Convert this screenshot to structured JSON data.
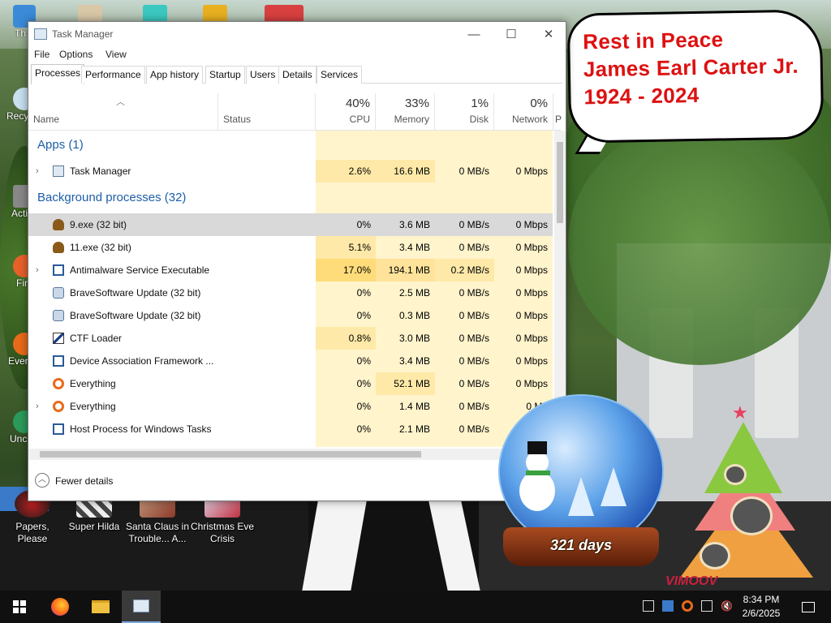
{
  "desktop": {
    "banner_lines": [
      "Rest in Peace",
      "James Earl Carter Jr.",
      "1924 - 2024"
    ],
    "edge_labels": [
      "Th",
      "Recy",
      "Acti",
      "Fir",
      "Ever",
      "Unc"
    ],
    "icons": [
      {
        "label": "Papers, Please"
      },
      {
        "label": "Super Hilda"
      },
      {
        "label": "Santa Claus in Trouble... A..."
      },
      {
        "label": "Christmas Eve Crisis"
      }
    ],
    "globe_label": "321 days",
    "watermark": "VIMOOV",
    "colors": {
      "banner_text": "#dd1111",
      "group_title": "#1c5ea8"
    }
  },
  "window": {
    "title": "Task Manager",
    "controls": {
      "minimize": "—",
      "maximize": "☐",
      "close": "✕"
    },
    "menu": [
      "File",
      "Options",
      "View"
    ],
    "tabs": [
      "Processes",
      "Performance",
      "App history",
      "Startup",
      "Users",
      "Details",
      "Services"
    ],
    "active_tab": "Processes",
    "columns": {
      "name": "Name",
      "status": "Status",
      "cpu": {
        "pct": "40%",
        "label": "CPU"
      },
      "memory": {
        "pct": "33%",
        "label": "Memory"
      },
      "disk": {
        "pct": "1%",
        "label": "Disk"
      },
      "network": {
        "pct": "0%",
        "label": "Network"
      },
      "power_partial": "P"
    },
    "groups": [
      {
        "title": "Apps (1)"
      },
      {
        "title": "Background processes (32)"
      }
    ],
    "apps": [
      {
        "name": "Task Manager",
        "expandable": true,
        "icon": "task-manager-icon",
        "cpu": "2.6%",
        "memory": "16.6 MB",
        "disk": "0 MB/s",
        "network": "0 Mbps"
      }
    ],
    "background": [
      {
        "name": "9.exe (32 bit)",
        "expandable": false,
        "icon": "poop-icon",
        "cpu": "0%",
        "memory": "3.6 MB",
        "disk": "0 MB/s",
        "network": "0 Mbps",
        "selected": true
      },
      {
        "name": "11.exe (32 bit)",
        "expandable": false,
        "icon": "poop-icon",
        "cpu": "5.1%",
        "memory": "3.4 MB",
        "disk": "0 MB/s",
        "network": "0 Mbps"
      },
      {
        "name": "Antimalware Service Executable",
        "expandable": true,
        "icon": "window-icon",
        "cpu": "17.0%",
        "memory": "194.1 MB",
        "disk": "0.2 MB/s",
        "network": "0 Mbps"
      },
      {
        "name": "BraveSoftware Update (32 bit)",
        "expandable": false,
        "icon": "update-icon",
        "cpu": "0%",
        "memory": "2.5 MB",
        "disk": "0 MB/s",
        "network": "0 Mbps"
      },
      {
        "name": "BraveSoftware Update (32 bit)",
        "expandable": false,
        "icon": "update-icon",
        "cpu": "0%",
        "memory": "0.3 MB",
        "disk": "0 MB/s",
        "network": "0 Mbps"
      },
      {
        "name": "CTF Loader",
        "expandable": false,
        "icon": "pen-icon",
        "cpu": "0.8%",
        "memory": "3.0 MB",
        "disk": "0 MB/s",
        "network": "0 Mbps"
      },
      {
        "name": "Device Association Framework ...",
        "expandable": false,
        "icon": "window-icon",
        "cpu": "0%",
        "memory": "3.4 MB",
        "disk": "0 MB/s",
        "network": "0 Mbps"
      },
      {
        "name": "Everything",
        "expandable": false,
        "icon": "magnifier-icon",
        "cpu": "0%",
        "memory": "52.1 MB",
        "disk": "0 MB/s",
        "network": "0 Mbps"
      },
      {
        "name": "Everything",
        "expandable": true,
        "icon": "magnifier-icon",
        "cpu": "0%",
        "memory": "1.4 MB",
        "disk": "0 MB/s",
        "network": "0 Mb"
      },
      {
        "name": "Host Process for Windows Tasks",
        "expandable": false,
        "icon": "window-icon",
        "cpu": "0%",
        "memory": "2.1 MB",
        "disk": "0 MB/s",
        "network": ""
      }
    ],
    "footer": {
      "fewer_details": "Fewer details"
    }
  },
  "taskbar": {
    "time": "8:34 PM",
    "date": "2/6/2025"
  }
}
